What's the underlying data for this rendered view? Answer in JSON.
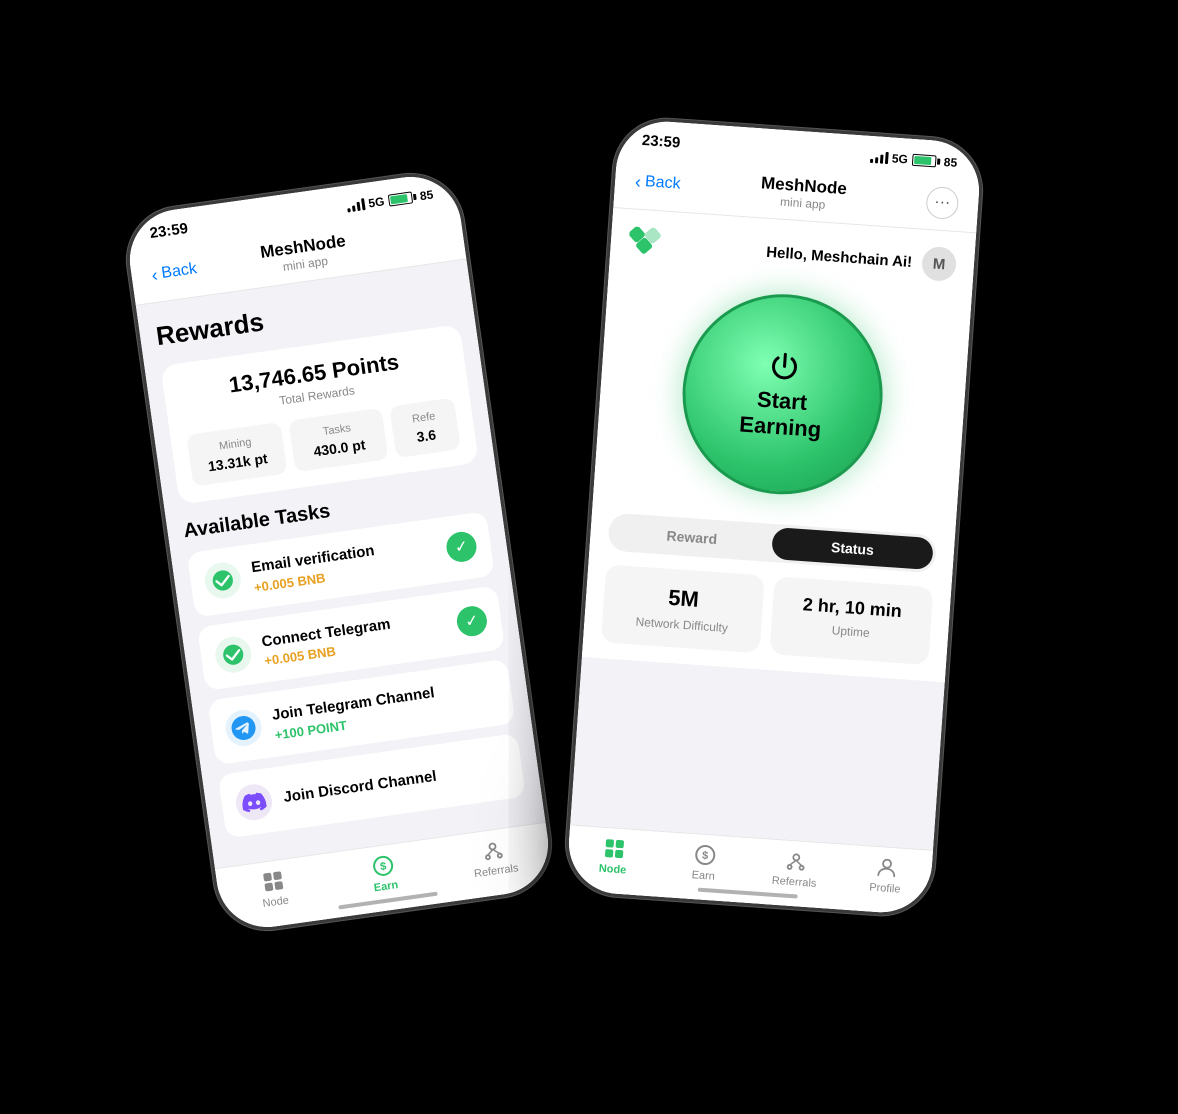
{
  "background": "#000000",
  "phone_back": {
    "status_time": "23:59",
    "network": "5G",
    "battery": "85",
    "nav_back": "Back",
    "nav_title": "MeshNode",
    "nav_subtitle": "mini app",
    "rewards_title": "Rewards",
    "total_points_value": "13,746.65 Points",
    "total_points_label": "Total Rewards",
    "mining_label": "Mining",
    "mining_value": "13.31k pt",
    "tasks_label": "Tasks",
    "tasks_value": "430.0 pt",
    "ref_label": "Refe",
    "ref_value": "3.6",
    "available_tasks": "Available Tasks",
    "tasks": [
      {
        "name": "Email verification",
        "reward": "+0.005 BNB",
        "reward_color": "gold",
        "icon": "✅",
        "icon_bg": "green",
        "checked": true
      },
      {
        "name": "Connect Telegram",
        "reward": "+0.005 BNB",
        "reward_color": "gold",
        "icon": "✅",
        "icon_bg": "green",
        "checked": true
      },
      {
        "name": "Join Telegram Channel",
        "reward": "+100 POINT",
        "reward_color": "green",
        "icon": "telegram",
        "icon_bg": "telegram"
      },
      {
        "name": "Join Discord Channel",
        "reward": "",
        "icon": "discord",
        "icon_bg": "discord"
      }
    ],
    "tab_items": [
      {
        "label": "Node",
        "active": false
      },
      {
        "label": "Earn",
        "active": true
      },
      {
        "label": "Referrals",
        "active": false
      }
    ]
  },
  "phone_front": {
    "status_time": "23:59",
    "network": "5G",
    "battery": "85",
    "nav_back": "Back",
    "nav_title": "MeshNode",
    "nav_subtitle": "mini app",
    "greeting": "Hello, Meshchain Ai!",
    "avatar_letter": "M",
    "earn_button_line1": "Start",
    "earn_button_line2": "Earning",
    "tab_reward": "Reward",
    "tab_status": "Status",
    "stats": [
      {
        "value": "5M",
        "label": "Network Difficulty"
      },
      {
        "value": "2 hr, 10 min",
        "label": "Uptime"
      }
    ],
    "tab_items": [
      {
        "label": "Node",
        "active": true
      },
      {
        "label": "Earn",
        "active": false
      },
      {
        "label": "Referrals",
        "active": false
      },
      {
        "label": "Profile",
        "active": false
      }
    ]
  }
}
